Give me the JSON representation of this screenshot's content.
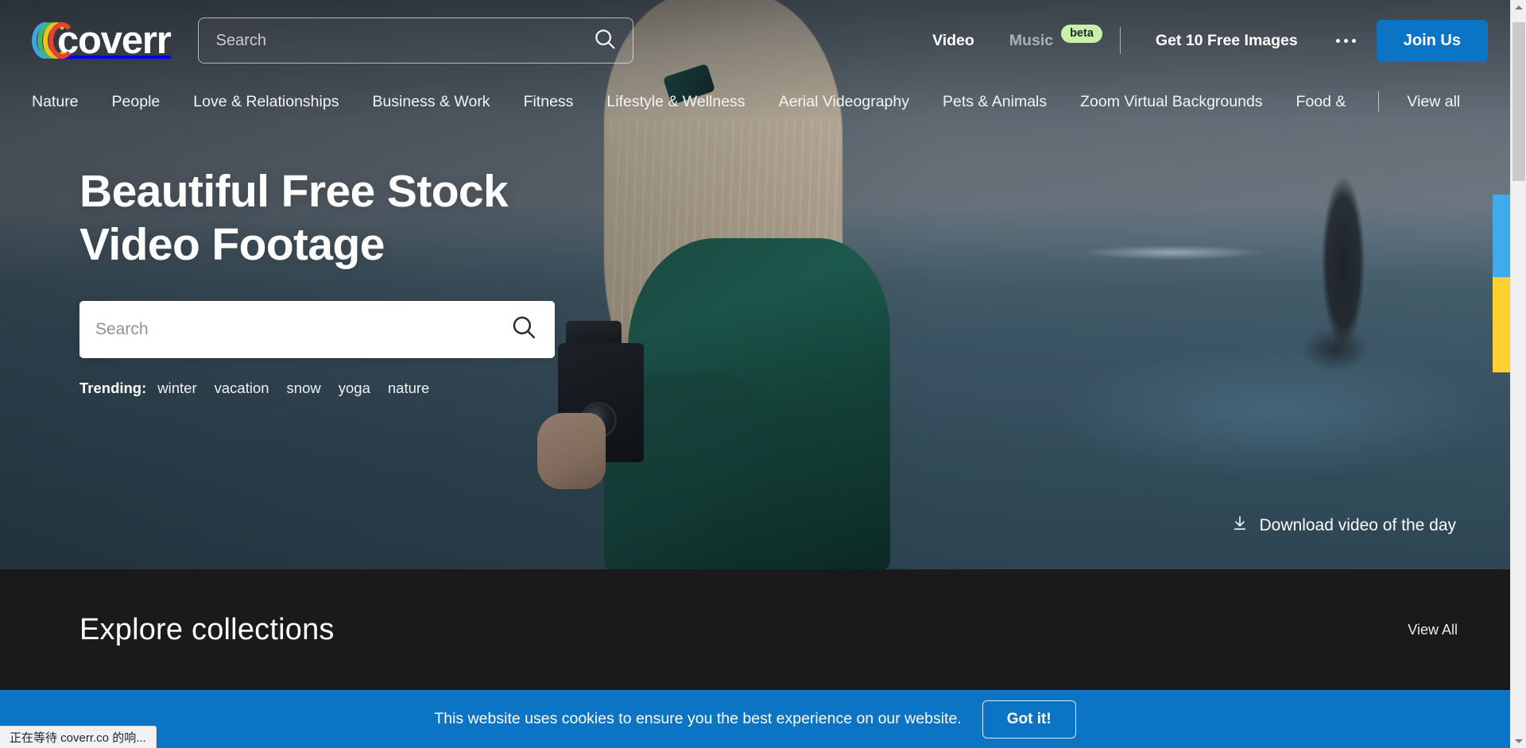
{
  "brand": {
    "logo_text": "coverr",
    "logo_colors": [
      "#3da5e0",
      "#49b56b",
      "#f2c11d",
      "#e8432f"
    ]
  },
  "header": {
    "search": {
      "placeholder": "Search",
      "value": "",
      "icon": "search-icon"
    },
    "nav": [
      {
        "label": "Video",
        "state": "active"
      },
      {
        "label": "Music",
        "state": "muted",
        "badge": "beta"
      }
    ],
    "free_images_link": "Get 10 Free Images",
    "more_menu": "•••",
    "join_button": "Join Us",
    "accent_color": "#0b74c4",
    "badge_color": "#c8f0a8"
  },
  "categories": {
    "items": [
      "Nature",
      "People",
      "Love & Relationships",
      "Business & Work",
      "Fitness",
      "Lifestyle & Wellness",
      "Aerial Videography",
      "Pets & Animals",
      "Zoom Virtual Backgrounds",
      "Food &"
    ],
    "view_all": "View all"
  },
  "hero": {
    "title_line1": "Beautiful Free Stock",
    "title_line2": "Video Footage",
    "search": {
      "placeholder": "Search",
      "value": "",
      "icon": "search-icon"
    },
    "trending_label": "Trending:",
    "trending_tags": [
      "winter",
      "vacation",
      "snow",
      "yoga",
      "nature"
    ],
    "download_link": "Download video of the day",
    "download_icon": "download-icon"
  },
  "explore": {
    "title": "Explore collections",
    "view_all": "View All",
    "background_color": "#1a1a1c"
  },
  "cookie_banner": {
    "message": "This website uses cookies to ensure you the best experience on our website.",
    "button": "Got it!",
    "background_color": "#0b74c4"
  },
  "side_tabs": {
    "blue_color": "#40aaed",
    "yellow_color": "#ffd02e"
  },
  "browser": {
    "status_text": "正在等待 coverr.co 的响..."
  }
}
